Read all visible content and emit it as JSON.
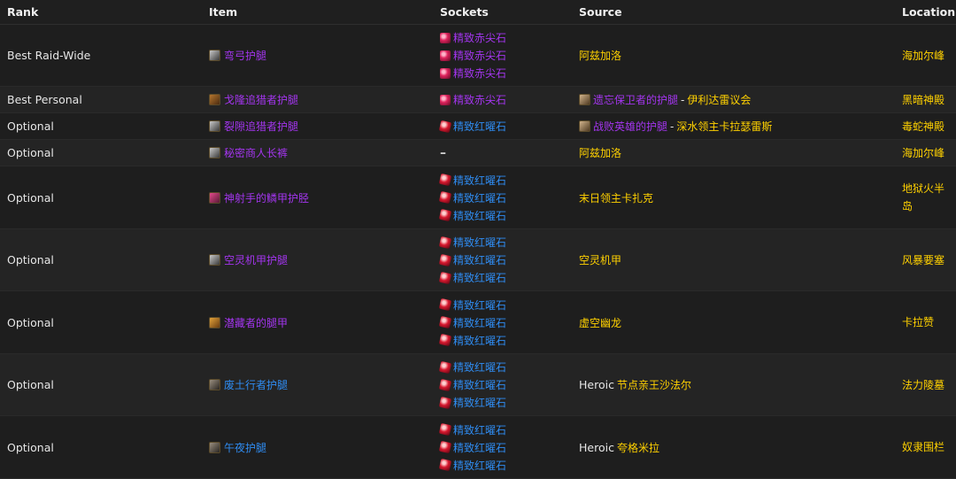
{
  "headers": {
    "rank": "Rank",
    "item": "Item",
    "sockets": "Sockets",
    "source": "Source",
    "location": "Location"
  },
  "rows": [
    {
      "rank": "Best Raid-Wide",
      "item": {
        "name": "弯弓护腿",
        "icon": "leg-armor-grey-icon",
        "color": "#a335ee"
      },
      "gems": [
        "精致赤尖石",
        "精致赤尖石",
        "精致赤尖石"
      ],
      "gem_type": "crimson",
      "source": {
        "prefix": "",
        "main": "阿兹加洛",
        "item": "",
        "npc": ""
      },
      "location": "海加尔峰"
    },
    {
      "rank": "Best Personal",
      "item": {
        "name": "戈隆追猎者护腿",
        "icon": "leg-armor-brown-icon",
        "color": "#a335ee"
      },
      "gems": [
        "精致赤尖石"
      ],
      "gem_type": "crimson",
      "source": {
        "prefix": "",
        "main": "",
        "item": "遗忘保卫者的护腿",
        "npc": "伊利达雷议会"
      },
      "location": "黑暗神殿"
    },
    {
      "rank": "Optional",
      "item": {
        "name": "裂隙追猎者护腿",
        "icon": "leg-armor-grey-icon",
        "color": "#a335ee"
      },
      "gems": [
        "精致红曜石"
      ],
      "gem_type": "ruby",
      "source": {
        "prefix": "",
        "main": "",
        "item": "战败英雄的护腿",
        "npc": "深水领主卡拉瑟雷斯"
      },
      "location": "毒蛇神殿"
    },
    {
      "rank": "Optional",
      "item": {
        "name": "秘密商人长裤",
        "icon": "leg-armor-grey-icon",
        "color": "#a335ee"
      },
      "gems": [],
      "gem_type": "none",
      "no_socket": "–",
      "source": {
        "prefix": "",
        "main": "阿兹加洛",
        "item": "",
        "npc": ""
      },
      "location": "海加尔峰"
    },
    {
      "rank": "Optional",
      "item": {
        "name": "神射手的鳞甲护胫",
        "icon": "leg-armor-pink-icon",
        "color": "#a335ee"
      },
      "gems": [
        "精致红曜石",
        "精致红曜石",
        "精致红曜石"
      ],
      "gem_type": "ruby",
      "source": {
        "prefix": "",
        "main": "末日领主卡扎克",
        "item": "",
        "npc": ""
      },
      "location": "地狱火半岛"
    },
    {
      "rank": "Optional",
      "item": {
        "name": "空灵机甲护腿",
        "icon": "leg-armor-grey-icon",
        "color": "#a335ee"
      },
      "gems": [
        "精致红曜石",
        "精致红曜石",
        "精致红曜石"
      ],
      "gem_type": "ruby",
      "source": {
        "prefix": "",
        "main": "空灵机甲",
        "item": "",
        "npc": ""
      },
      "location": "风暴要塞"
    },
    {
      "rank": "Optional",
      "item": {
        "name": "潜藏者的腿甲",
        "icon": "leg-armor-orange-icon",
        "color": "#a335ee"
      },
      "gems": [
        "精致红曜石",
        "精致红曜石",
        "精致红曜石"
      ],
      "gem_type": "ruby",
      "source": {
        "prefix": "",
        "main": "虚空幽龙",
        "item": "",
        "npc": ""
      },
      "location": "卡拉赞"
    },
    {
      "rank": "Optional",
      "item": {
        "name": "废土行者护腿",
        "icon": "leg-armor-dark-icon",
        "color": "#2f8cf2"
      },
      "gems": [
        "精致红曜石",
        "精致红曜石",
        "精致红曜石"
      ],
      "gem_type": "ruby",
      "source": {
        "prefix": "Heroic",
        "main": "节点亲王沙法尔",
        "item": "",
        "npc": ""
      },
      "location": "法力陵墓"
    },
    {
      "rank": "Optional",
      "item": {
        "name": "午夜护腿",
        "icon": "leg-armor-dark-icon",
        "color": "#2f8cf2"
      },
      "gems": [
        "精致红曜石",
        "精致红曜石",
        "精致红曜石"
      ],
      "gem_type": "ruby",
      "source": {
        "prefix": "Heroic",
        "main": "夸格米拉",
        "item": "",
        "npc": ""
      },
      "location": "奴隶围栏"
    }
  ]
}
